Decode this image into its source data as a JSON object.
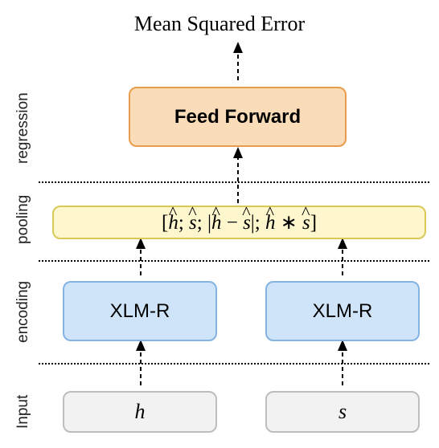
{
  "title": "Mean Squared Error",
  "sections": {
    "regression": "regression",
    "pooling": "pooling",
    "encoding": "encoding",
    "input": "Input"
  },
  "boxes": {
    "feed_forward": "Feed Forward",
    "pool_formula_parts": {
      "open": "[",
      "h": "h",
      "sep1": "; ",
      "s": "s",
      "sep2": "; |",
      "h2": "h",
      "minus": " − ",
      "s2": "s",
      "sep3": "|; ",
      "h3": "h",
      "star": " ∗ ",
      "s3": "s",
      "close": "]"
    },
    "encoder": "XLM-R",
    "input_h": "h",
    "input_s": "s"
  },
  "colors": {
    "ff_fill": "#fbdcb8",
    "ff_border": "#e79d4b",
    "pool_fill": "#fef7cd",
    "pool_border": "#d8c957",
    "enc_fill": "#d0e4f9",
    "enc_border": "#84b4e2",
    "in_fill": "#f2f2f2",
    "in_border": "#bdbdbd"
  }
}
